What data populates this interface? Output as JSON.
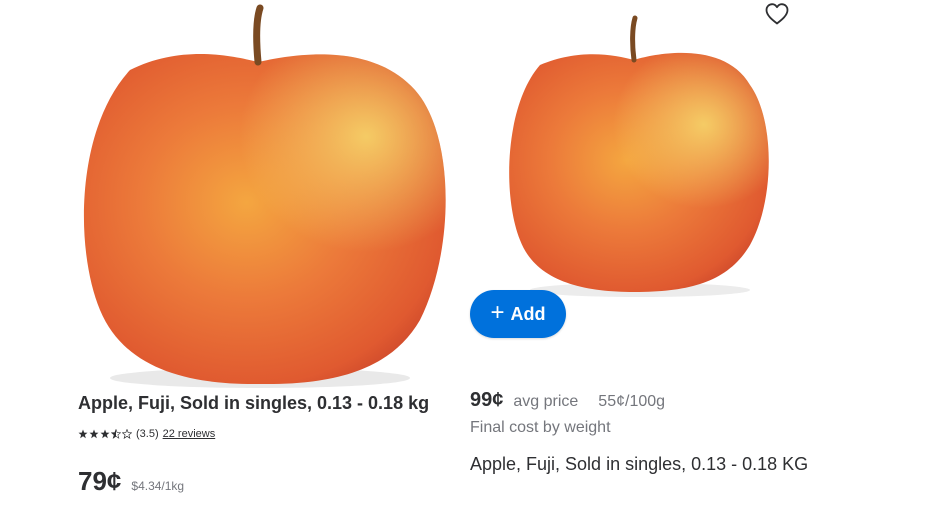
{
  "products": [
    {
      "title": "Apple, Fuji, Sold in singles, 0.13 - 0.18 kg",
      "rating_text": "(3.5)",
      "rating_value": 3.5,
      "rating_max": 5,
      "reviews_text": "22 reviews",
      "price": "79¢",
      "unit_price": "$4.34/1kg",
      "image_icon": "apple-image"
    },
    {
      "price": "99¢",
      "avg_label": "avg price",
      "per_100g": "55¢/100g",
      "final_cost": "Final cost by weight",
      "title": "Apple, Fuji, Sold in singles, 0.13 - 0.18 KG",
      "add_label": "Add",
      "add_icon": "plus-icon",
      "favorite_icon": "heart-icon",
      "image_icon": "apple-image",
      "accent_color": "#0071dc"
    }
  ]
}
